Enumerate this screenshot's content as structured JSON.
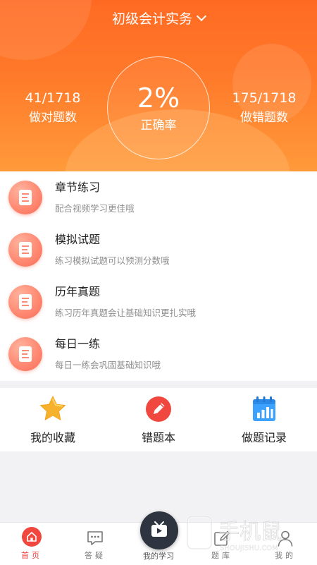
{
  "header": {
    "title": "初级会计实务",
    "correct": {
      "count": "41/1718",
      "label": "做对题数"
    },
    "rate": {
      "value": "2%",
      "label": "正确率"
    },
    "wrong": {
      "count": "175/1718",
      "label": "做错题数"
    }
  },
  "practice": [
    {
      "title": "章节练习",
      "subtitle": "配合视频学习更佳哦"
    },
    {
      "title": "模拟试题",
      "subtitle": "练习模拟试题可以预测分数哦"
    },
    {
      "title": "历年真题",
      "subtitle": "练习历年真题会让基础知识更扎实哦"
    },
    {
      "title": "每日一练",
      "subtitle": "每日一练会巩固基础知识哦"
    }
  ],
  "tools": [
    {
      "label": "我的收藏",
      "icon": "star-icon"
    },
    {
      "label": "错题本",
      "icon": "pencil-icon"
    },
    {
      "label": "做题记录",
      "icon": "chart-calendar-icon"
    }
  ],
  "nav": {
    "home": "首页",
    "qa": "答疑",
    "study": "我的学习",
    "bank": "题库",
    "mine": "我的"
  },
  "watermark": {
    "main": "手机鼠",
    "sub": "SHOUJISHU.COM"
  },
  "colors": {
    "accent": "#ff6a23",
    "active_nav": "#f03a3a",
    "icon_coral": "#ff8a73"
  }
}
